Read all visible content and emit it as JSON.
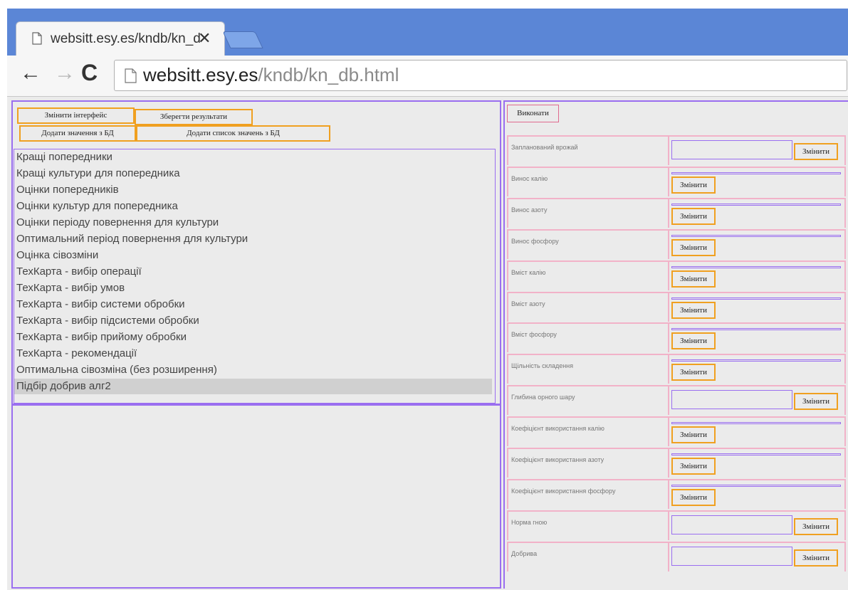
{
  "browser": {
    "tab_title": "websitt.esy.es/kndb/kn_d",
    "url_host": "websitt.esy.es",
    "url_path": "/kndb/kn_db.html"
  },
  "left": {
    "buttons": {
      "change_interface": "Змінити інтерфейс",
      "save_results": "Зберегти результати",
      "add_value": "Додати значення з БД",
      "add_value_list": "Додати список значень з БД"
    },
    "list_items": [
      "Кращі попередники",
      "Кращі культури для попередника",
      "Оцінки попередників",
      "Оцінки культур для попередника",
      "Оцінки періоду повернення для культури",
      "Оптимальний період повернення для культури",
      "Оцінка сівозміни",
      "ТехКарта - вибір операції",
      "ТехКарта - вибір умов",
      "ТехКарта - вибір системи обробки",
      "ТехКарта - вибір підсистеми обробки",
      "ТехКарта - вибір прийому обробки",
      "ТехКарта - рекомендації",
      "Оптимальна сівозміна (без розширення)",
      "Підбір добрив алг2"
    ],
    "selected_item": "Підбір добрив алг2"
  },
  "right": {
    "run_label": "Виконати",
    "change_label": "Змінити",
    "params": [
      {
        "label": "Запланований врожай"
      },
      {
        "label": "Винос калію"
      },
      {
        "label": "Винос азоту"
      },
      {
        "label": "Винос фосфору"
      },
      {
        "label": "Вміст калію"
      },
      {
        "label": "Вміст азоту"
      },
      {
        "label": "Вміст фосфору"
      },
      {
        "label": "Щільність складення"
      },
      {
        "label": "Глибина орного шару"
      },
      {
        "label": "Коефіцієнт використання калію"
      },
      {
        "label": "Коефіцієнт використання азоту"
      },
      {
        "label": "Коефіцієнт використання фосфору"
      },
      {
        "label": "Норма гною"
      },
      {
        "label": "Добрива"
      }
    ]
  },
  "colors": {
    "chrome_frame": "#5b86d6",
    "panel_border": "#9a6ef0",
    "button_border": "#f0a020",
    "row_border": "#f2b2c8"
  }
}
